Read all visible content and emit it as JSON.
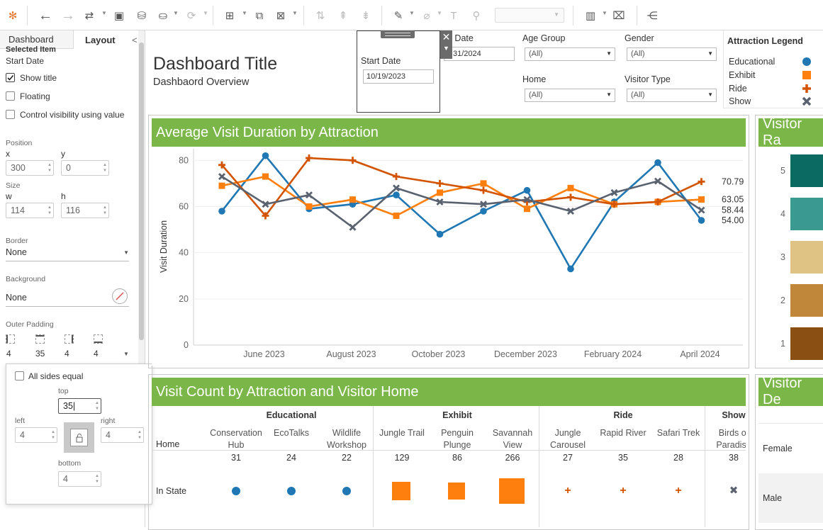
{
  "left_panel": {
    "tabs": [
      "Dashboard",
      "Layout"
    ],
    "collapse_glyph": "<",
    "selected_item_label": "Selected Item",
    "selected_item_value": "Start Date",
    "show_title": "Show title",
    "floating": "Floating",
    "control_visibility": "Control visibility using value",
    "position_label": "Position",
    "x_label": "x",
    "x_value": "300",
    "y_label": "y",
    "y_value": "0",
    "size_label": "Size",
    "w_label": "w",
    "w_value": "114",
    "h_label": "h",
    "h_value": "116",
    "border_label": "Border",
    "border_value": "None",
    "background_label": "Background",
    "background_value": "None",
    "outer_padding_label": "Outer Padding",
    "padding_values": [
      "4",
      "35",
      "4",
      "4"
    ]
  },
  "padding_popup": {
    "all_sides_equal": "All sides equal",
    "top_label": "top",
    "top_value": "35|",
    "left_label": "left",
    "left_value": "4",
    "right_label": "right",
    "right_value": "4",
    "bottom_label": "bottom",
    "bottom_value": "4"
  },
  "dashboard": {
    "title": "Dashboard Title",
    "subtitle": "Dashbaord Overview",
    "start_date_label": "Start Date",
    "start_date_value": "10/19/2023",
    "end_date_label": "d Date",
    "end_date_value": "31/2024",
    "filters": [
      {
        "label": "Age Group",
        "value": "(All)"
      },
      {
        "label": "Gender",
        "value": "(All)"
      },
      {
        "label": "Home",
        "value": "(All)"
      },
      {
        "label": "Visitor Type",
        "value": "(All)"
      }
    ],
    "legend_title": "Attraction Legend",
    "legend": [
      {
        "name": "Educational",
        "color": "#1f77b4",
        "shape": "circle"
      },
      {
        "name": "Exhibit",
        "color": "#ff7f0e",
        "shape": "square"
      },
      {
        "name": "Ride",
        "color": "#d35400",
        "shape": "plus"
      },
      {
        "name": "Show",
        "color": "#5a6270",
        "shape": "cross"
      }
    ],
    "line_chart_title": "Average Visit Duration by Attraction",
    "rating_title": "Visitor Ra",
    "rating_labels": [
      "5",
      "4",
      "3",
      "2",
      "1"
    ],
    "rating_colors": [
      "#0b6b63",
      "#3a9a92",
      "#dfc384",
      "#c0873a",
      "#8a4f13"
    ],
    "table_title": "Visit Count by Attraction and Visitor Home",
    "demo_title": "Visitor De",
    "demo_rows": [
      "Female",
      "Male"
    ]
  },
  "chart_data": {
    "type": "line",
    "title": "Average Visit Duration by Attraction",
    "ylabel": "Visit Duration",
    "xlabel": "",
    "ylim": [
      0,
      85
    ],
    "yticks": [
      0,
      20,
      40,
      60,
      80
    ],
    "xticks": [
      "June 2023",
      "August 2023",
      "October 2023",
      "December 2023",
      "February 2024",
      "April 2024"
    ],
    "x": [
      "2023-05",
      "2023-06",
      "2023-07",
      "2023-08",
      "2023-09",
      "2023-10",
      "2023-11",
      "2023-12",
      "2024-01",
      "2024-02",
      "2024-03",
      "2024-04",
      "2024-05"
    ],
    "series": [
      {
        "name": "Educational",
        "color": "#1f77b4",
        "shape": "circle",
        "values": [
          58,
          82,
          59,
          61,
          65,
          48,
          58,
          67,
          33,
          62,
          79,
          54
        ],
        "end_label": "54.00"
      },
      {
        "name": "Exhibit",
        "color": "#ff7f0e",
        "shape": "square",
        "values": [
          69,
          73,
          60,
          63,
          56,
          66,
          70,
          59,
          68,
          61,
          62,
          63.05
        ],
        "end_label": "63.05"
      },
      {
        "name": "Ride",
        "color": "#d35400",
        "shape": "plus",
        "values": [
          78,
          56,
          81,
          80,
          73,
          70,
          67,
          62,
          64,
          61,
          62,
          70.79
        ],
        "end_label": "70.79"
      },
      {
        "name": "Show",
        "color": "#5a6270",
        "shape": "cross",
        "values": [
          73,
          61,
          65,
          51,
          68,
          62,
          61,
          63,
          58,
          66,
          71,
          58.44
        ],
        "end_label": "58.44"
      }
    ],
    "x_index": [
      0,
      1,
      2,
      3,
      4,
      5,
      6,
      7,
      8,
      9,
      10,
      11
    ]
  },
  "table_data": {
    "row_header": "Home",
    "groups": [
      {
        "name": "Educational",
        "items": [
          {
            "name": "Conservation Hub",
            "count": "31"
          },
          {
            "name": "EcoTalks",
            "count": "24"
          },
          {
            "name": "Wildlife Workshop",
            "count": "22"
          }
        ]
      },
      {
        "name": "Exhibit",
        "items": [
          {
            "name": "Jungle Trail",
            "count": "129"
          },
          {
            "name": "Penguin Plunge",
            "count": "86"
          },
          {
            "name": "Savannah View",
            "count": "266"
          }
        ]
      },
      {
        "name": "Ride",
        "items": [
          {
            "name": "Jungle Carousel",
            "count": "27"
          },
          {
            "name": "Rapid River",
            "count": "35"
          },
          {
            "name": "Safari Trek",
            "count": "28"
          }
        ]
      },
      {
        "name": "Show",
        "items": [
          {
            "name": "Birds of Paradise",
            "count": "38"
          }
        ]
      }
    ],
    "row_label": "In State"
  }
}
